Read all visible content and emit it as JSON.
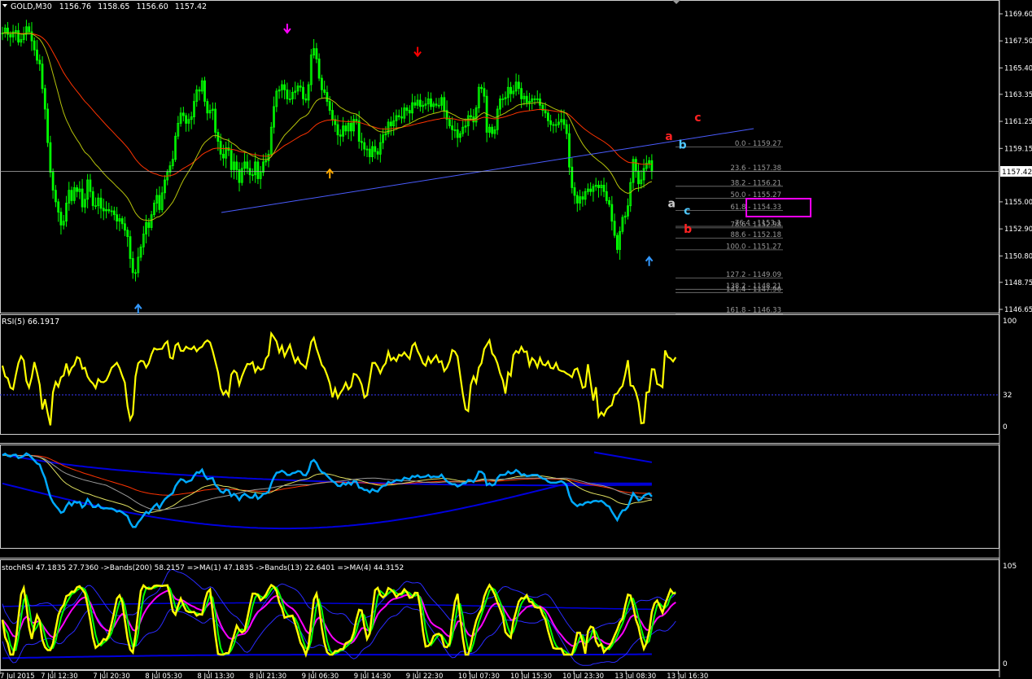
{
  "window": {
    "symbol": "GOLD,M30",
    "open": "1156.76",
    "high": "1158.65",
    "low": "1156.60",
    "close": "1157.42",
    "current_price_tag": "1157.42"
  },
  "colors": {
    "background": "#000000",
    "candles": "#00ff00",
    "ma_slow": "#ff3300",
    "ma_fast": "#b5c20a",
    "trendline": "#4a5cff",
    "rsi": "#ffff00",
    "mid_line": "#00aaff",
    "band": "#0000dd",
    "stoch_fast": "#ffff00",
    "stoch_mid": "#00ff00",
    "stoch_signal": "#ff00ff",
    "fib_box": "#ff00ff",
    "arrow_down_magenta": "#ff00ff",
    "arrow_down_red": "#ff0000",
    "arrow_up_blue": "#3399ff",
    "arrow_up_orange": "#ffaa00"
  },
  "chart_data": [
    {
      "type": "candlestick",
      "name": "main",
      "ylim": [
        1146.65,
        1169.6
      ],
      "price_axis_ticks": [
        "1169.60",
        "1167.50",
        "1165.40",
        "1163.35",
        "1161.25",
        "1159.15",
        "1155.00",
        "1152.90",
        "1150.80",
        "1148.75",
        "1146.65"
      ],
      "close_series": [
        1168.1,
        1168.5,
        1168.0,
        1167.8,
        1168.2,
        1168.3,
        1167.4,
        1167.6,
        1168.0,
        1168.6,
        1168.2,
        1167.5,
        1166.8,
        1166.0,
        1165.7,
        1163.8,
        1162.2,
        1159.6,
        1157.3,
        1155.9,
        1155.0,
        1154.2,
        1153.2,
        1153.5,
        1154.9,
        1155.9,
        1155.1,
        1156.1,
        1155.8,
        1156.0,
        1154.6,
        1155.2,
        1156.7,
        1155.8,
        1154.7,
        1154.7,
        1155.3,
        1154.5,
        1154.3,
        1154.4,
        1154.3,
        1154.3,
        1154.0,
        1153.5,
        1153.7,
        1153.3,
        1152.8,
        1152.3,
        1150.6,
        1149.5,
        1149.5,
        1150.7,
        1151.5,
        1152.5,
        1153.4,
        1153.0,
        1154.0,
        1154.9,
        1155.5,
        1154.4,
        1155.7,
        1156.7,
        1157.3,
        1157.8,
        1158.3,
        1160.1,
        1161.1,
        1161.9,
        1161.7,
        1161.1,
        1161.4,
        1161.6,
        1162.8,
        1163.7,
        1163.6,
        1164.4,
        1162.8,
        1161.9,
        1162.1,
        1162.2,
        1160.4,
        1159.7,
        1158.7,
        1158.4,
        1159.2,
        1159.0,
        1157.5,
        1158.1,
        1157.5,
        1156.5,
        1157.6,
        1158.1,
        1157.6,
        1157.1,
        1157.1,
        1158.1,
        1156.8,
        1157.3,
        1158.1,
        1158.2,
        1158.7,
        1160.8,
        1162.4,
        1163.6,
        1163.7,
        1164.1,
        1163.7,
        1163.0,
        1163.0,
        1163.5,
        1163.6,
        1164.0,
        1163.9,
        1163.0,
        1162.9,
        1164.1,
        1166.4,
        1166.9,
        1166.1,
        1164.6,
        1163.7,
        1163.5,
        1162.8,
        1162.1,
        1161.4,
        1161.0,
        1160.2,
        1160.1,
        1160.9,
        1160.5,
        1161.1,
        1160.5,
        1161.4,
        1161.3,
        1159.7,
        1159.6,
        1159.1,
        1159.1,
        1158.5,
        1159.3,
        1158.9,
        1158.7,
        1159.6,
        1160.2,
        1160.3,
        1161.2,
        1160.9,
        1161.3,
        1161.7,
        1161.6,
        1161.5,
        1162.3,
        1162.1,
        1161.9,
        1162.7,
        1162.5,
        1162.9,
        1162.4,
        1162.5,
        1162.6,
        1163.0,
        1162.4,
        1162.6,
        1162.5,
        1162.5,
        1163.1,
        1162.1,
        1161.4,
        1160.9,
        1160.6,
        1160.6,
        1160.0,
        1160.3,
        1160.8,
        1160.9,
        1161.7,
        1161.6,
        1161.2,
        1162.3,
        1163.9,
        1163.8,
        1163.2,
        1160.4,
        1160.8,
        1160.3,
        1160.6,
        1162.2,
        1163.0,
        1163.0,
        1163.1,
        1163.9,
        1163.4,
        1163.6,
        1164.3,
        1163.8,
        1163.0,
        1163.2,
        1162.7,
        1162.8,
        1163.0,
        1163.0,
        1163.0,
        1162.5,
        1162.1,
        1161.9,
        1161.3,
        1161.0,
        1161.0,
        1161.0,
        1161.2,
        1161.4,
        1161.0,
        1160.3,
        1157.7,
        1156.1,
        1155.5,
        1154.9,
        1155.4,
        1155.2,
        1155.8,
        1156.0,
        1155.8,
        1156.2,
        1156.3,
        1156.1,
        1156.3,
        1155.8,
        1155.1,
        1154.8,
        1153.5,
        1152.4,
        1151.3,
        1152.7,
        1153.8,
        1153.9,
        1154.7,
        1156.5,
        1158.3,
        1157.4,
        1156.4,
        1156.7,
        1157.6,
        1158.0,
        1158.2,
        1157.4
      ],
      "x_axis_labels": [
        "7 Jul 2015",
        "7 Jul 12:30",
        "7 Jul 20:30",
        "8 Jul 05:30",
        "8 Jul 13:30",
        "8 Jul 21:30",
        "9 Jul 06:30",
        "9 Jul 14:30",
        "9 Jul 22:30",
        "10 Jul 07:30",
        "10 Jul 15:30",
        "10 Jul 23:30",
        "13 Jul 08:30",
        "13 Jul 16:30"
      ],
      "fibonacci_levels": [
        {
          "label": "0.0 - 1159.27",
          "price": 1159.27
        },
        {
          "label": "23.6 - 1157.38",
          "price": 1157.38
        },
        {
          "label": "38.2 - 1156.21",
          "price": 1156.21
        },
        {
          "label": "50.0 - 1155.27",
          "price": 1155.27
        },
        {
          "label": "61.8 - 1154.33",
          "price": 1154.33
        },
        {
          "label": "76.4 - 1153.1",
          "price": 1153.1
        },
        {
          "label": "78.6 - 1152.98",
          "price": 1152.98
        },
        {
          "label": "88.6 - 1152.18",
          "price": 1152.18
        },
        {
          "label": "100.0 - 1151.27",
          "price": 1151.27
        },
        {
          "label": "127.2 - 1149.09",
          "price": 1149.09
        },
        {
          "label": "138.2 - 1148.21",
          "price": 1148.21
        },
        {
          "label": "141.4 - 1147.96",
          "price": 1147.96
        },
        {
          "label": "161.8 - 1146.33",
          "price": 1146.33
        }
      ],
      "wave_labels": [
        {
          "text": "a",
          "color": "#ff2222",
          "bar": 249,
          "price": 1159.8
        },
        {
          "text": "b",
          "color": "#4fc8ff",
          "bar": 254,
          "price": 1159.15
        },
        {
          "text": "c",
          "color": "#ff2222",
          "bar": 260,
          "price": 1161.25
        },
        {
          "text": "a",
          "color": "#cccccc",
          "bar": 250,
          "price": 1154.6
        },
        {
          "text": "c",
          "color": "#4fc8ff",
          "bar": 256,
          "price": 1154.0
        },
        {
          "text": "b",
          "color": "#ff2222",
          "bar": 256,
          "price": 1152.6
        }
      ],
      "arrows": [
        {
          "dir": "down",
          "color": "#ff00ff",
          "bar": 107,
          "price": 1168.2
        },
        {
          "dir": "down",
          "color": "#ff0000",
          "bar": 156,
          "price": 1166.4
        },
        {
          "dir": "up",
          "color": "#3399ff",
          "bar": 51,
          "price": 1146.95
        },
        {
          "dir": "up",
          "color": "#ffaa00",
          "bar": 123,
          "price": 1157.45
        },
        {
          "dir": "up",
          "color": "#3399ff",
          "bar": 243,
          "price": 1150.65
        }
      ]
    },
    {
      "type": "line",
      "name": "rsi",
      "label": "RSI(5) 66.1917",
      "ylim": [
        0,
        100
      ],
      "axis_ticks": [
        "100",
        "32",
        "0"
      ],
      "level": 32,
      "values": [
        58.4,
        48.3,
        46.4,
        37.6,
        36.1,
        49.4,
        60.8,
        67.2,
        63.3,
        44.0,
        37.7,
        47.5,
        61.7,
        51.9,
        40.2,
        17.0,
        26.7,
        13.5,
        2.0,
        33.2,
        42.9,
        38.6,
        47.3,
        49.1,
        60.4,
        50.4,
        56.2,
        58.9,
        66.5,
        65.1,
        55.5,
        56.4,
        48.0,
        44.0,
        41.5,
        37.2,
        45.6,
        43.0,
        42.7,
        44.4,
        49.8,
        56.3,
        58.5,
        61.1,
        56.1,
        48.7,
        42.4,
        19.9,
        7.4,
        12.3,
        48.1,
        60.6,
        62.9,
        62.5,
        56.6,
        60.7,
        69.0,
        74.8,
        73.6,
        74.0,
        74.2,
        79.0,
        81.3,
        66.1,
        64.9,
        77.5,
        79.5,
        72.5,
        72.2,
        76.3,
        74.5,
        73.9,
        76.5,
        71.9,
        74.9,
        76.2,
        80.3,
        82.3,
        80.3,
        72.2,
        62.2,
        52.0,
        36.8,
        31.1,
        34.5,
        29.9,
        50.0,
        53.7,
        51.4,
        40.2,
        48.3,
        54.6,
        60.0,
        59.6,
        61.7,
        52.5,
        57.2,
        54.4,
        55.8,
        65.0,
        68.2,
        88.8,
        85.2,
        81.2,
        71.1,
        77.0,
        67.2,
        72.6,
        78.0,
        69.0,
        61.4,
        66.1,
        60.6,
        58.8,
        56.1,
        67.6,
        80.7,
        84.7,
        74.6,
        67.4,
        59.0,
        55.8,
        49.4,
        41.7,
        28.4,
        36.7,
        27.9,
        32.8,
        36.5,
        42.2,
        36.0,
        38.8,
        50.6,
        49.8,
        46.2,
        40.3,
        28.3,
        30.5,
        45.6,
        60.9,
        61.1,
        57.1,
        51.3,
        57.4,
        60.6,
        71.5,
        63.5,
        65.9,
        62.8,
        68.7,
        67.7,
        70.9,
        67.6,
        64.8,
        77.0,
        79.8,
        72.2,
        67.3,
        60.7,
        58.4,
        66.4,
        61.1,
        64.8,
        68.0,
        61.6,
        62.6,
        53.3,
        56.5,
        62.6,
        73.1,
        71.6,
        67.1,
        49.3,
        31.5,
        17.2,
        15.5,
        40.4,
        48.0,
        42.2,
        56.6,
        60.7,
        74.0,
        78.0,
        82.3,
        69.9,
        66.7,
        60.5,
        51.1,
        44.5,
        32.0,
        51.8,
        48.9,
        68.5,
        72.2,
        70.4,
        76.1,
        71.3,
        71.8,
        58.5,
        65.5,
        62.9,
        56.9,
        65.6,
        59.6,
        58.6,
        62.3,
        56.3,
        55.6,
        60.8,
        54.5,
        53.3,
        52.8,
        50.9,
        49.6,
        47.5,
        54.5,
        55.8,
        47.3,
        37.5,
        38.5,
        59.7,
        42.4,
        25.4,
        38.0,
        10.2,
        14.2,
        11.3,
        17.0,
        19.5,
        21.0,
        30.9,
        32.1,
        36.4,
        39.2,
        50.3,
        63.5,
        39.6,
        39.0,
        33.3,
        24.0,
        3.9,
        4.4,
        32.9,
        33.6,
        55.0,
        54.8,
        41.0,
        40.0,
        38.1,
        72.8,
        66.6,
        65.2,
        62.4,
        66.2
      ]
    },
    {
      "type": "line",
      "name": "bands-panel",
      "series": [
        {
          "name": "",
          "color": "#00aaff",
          "values": [
            1168.1,
            1168.5,
            1168.0,
            1167.8,
            1168.2,
            1168.3,
            1167.4,
            1167.6,
            1168.0,
            1168.6,
            1168.2,
            1167.5,
            1166.8,
            1166.0,
            1165.7,
            1163.8,
            1162.2,
            1159.6,
            1157.3,
            1155.9,
            1155.0,
            1154.2,
            1153.2,
            1153.5,
            1154.9,
            1155.9,
            1155.1,
            1156.1,
            1155.8,
            1156.0,
            1154.6,
            1155.2,
            1156.7,
            1155.8,
            1154.7,
            1154.7,
            1155.3,
            1154.5,
            1154.3,
            1154.4,
            1154.3,
            1154.3,
            1154.0,
            1153.5,
            1153.7,
            1153.3,
            1152.8,
            1152.3,
            1150.6,
            1149.5,
            1149.5,
            1150.7,
            1151.5,
            1152.5,
            1153.4,
            1153.0,
            1154.0,
            1154.9,
            1155.5,
            1154.4,
            1155.7,
            1156.7,
            1157.3,
            1157.8,
            1158.3,
            1160.1,
            1161.1,
            1161.9,
            1161.7,
            1161.1,
            1161.4,
            1161.6,
            1162.8,
            1163.7,
            1163.6,
            1164.4,
            1162.8,
            1161.9,
            1162.1,
            1162.2,
            1160.4,
            1159.7,
            1158.7,
            1158.4,
            1159.2,
            1159.0,
            1157.5,
            1158.1,
            1157.5,
            1156.5,
            1157.6,
            1158.1,
            1157.6,
            1157.1,
            1157.1,
            1158.1,
            1156.8,
            1157.3,
            1158.1,
            1158.2,
            1158.7,
            1160.8,
            1162.4,
            1163.6,
            1163.7,
            1164.1,
            1163.7,
            1163.0,
            1163.0,
            1163.5,
            1163.6,
            1164.0,
            1163.9,
            1163.0,
            1162.9,
            1164.1,
            1166.4,
            1166.9,
            1166.1,
            1164.6,
            1163.7,
            1163.5,
            1162.8,
            1162.1,
            1161.4,
            1161.0,
            1160.2,
            1160.1,
            1160.9,
            1160.5,
            1161.1,
            1160.5,
            1161.4,
            1161.3,
            1159.7,
            1159.6,
            1159.1,
            1159.1,
            1158.5,
            1159.3,
            1158.9,
            1158.7,
            1159.6,
            1160.2,
            1160.3,
            1161.2,
            1160.9,
            1161.3,
            1161.7,
            1161.6,
            1161.5,
            1162.3,
            1162.1,
            1161.9,
            1162.7,
            1162.5,
            1162.9,
            1162.4,
            1162.5,
            1162.6,
            1163.0,
            1162.4,
            1162.6,
            1162.5,
            1162.5,
            1163.1,
            1162.1,
            1161.4,
            1160.9,
            1160.6,
            1160.6,
            1160.0,
            1160.3,
            1160.8,
            1160.9,
            1161.7,
            1161.6,
            1161.2,
            1162.3,
            1163.9,
            1163.8,
            1163.2,
            1160.4,
            1160.8,
            1160.3,
            1160.6,
            1162.2,
            1163.0,
            1163.0,
            1163.1,
            1163.9,
            1163.4,
            1163.6,
            1164.3,
            1163.8,
            1163.0,
            1163.2,
            1162.7,
            1162.8,
            1163.0,
            1163.0,
            1163.0,
            1162.5,
            1162.1,
            1161.9,
            1161.3,
            1161.0,
            1161.0,
            1161.0,
            1161.2,
            1161.4,
            1161.0,
            1160.3,
            1157.7,
            1156.1,
            1155.5,
            1154.9,
            1155.4,
            1155.2,
            1155.8,
            1156.0,
            1155.8,
            1156.2,
            1156.3,
            1156.1,
            1156.3,
            1155.8,
            1155.1,
            1154.8,
            1153.5,
            1152.4,
            1151.3,
            1152.7,
            1153.8,
            1153.9,
            1154.7,
            1156.5,
            1158.3,
            1157.4,
            1156.4,
            1156.7,
            1157.6,
            1158.0,
            1158.2,
            1157.4
          ]
        }
      ]
    },
    {
      "type": "line",
      "name": "stochrsi",
      "label": "stochRSI 47.1835 27.7360  ->Bands(200) 58.2157  =>MA(1) 47.1835  ->Bands(13) 22.6401  =>MA(4) 44.3152",
      "axis_ticks": [
        "105",
        "0"
      ]
    }
  ]
}
